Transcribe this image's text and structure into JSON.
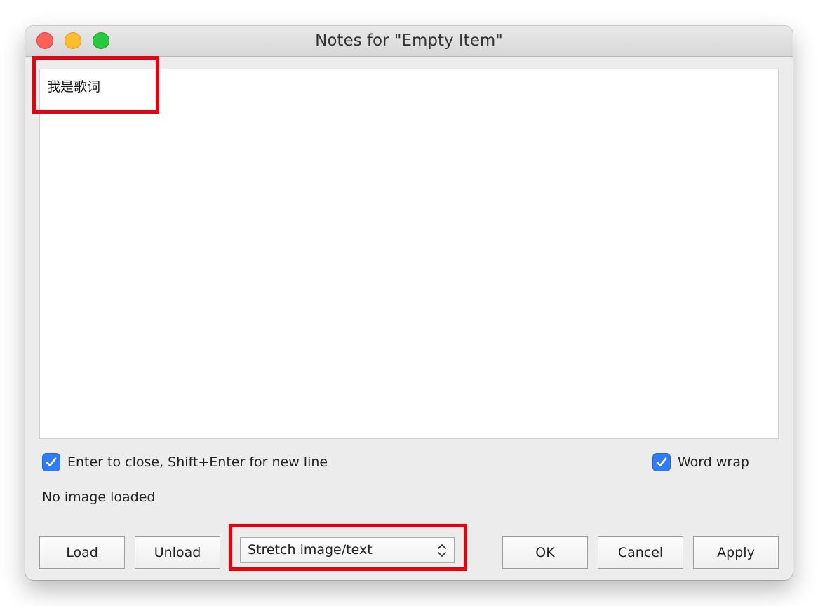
{
  "window": {
    "title": "Notes for \"Empty Item\""
  },
  "notes": {
    "text": "我是歌词"
  },
  "options": {
    "enter_to_close_label": "Enter to close, Shift+Enter for new line",
    "enter_to_close_checked": true,
    "word_wrap_label": "Word wrap",
    "word_wrap_checked": true
  },
  "image_status": "No image loaded",
  "buttons": {
    "load": "Load",
    "unload": "Unload",
    "ok": "OK",
    "cancel": "Cancel",
    "apply": "Apply"
  },
  "display_mode": {
    "selected": "Stretch image/text"
  },
  "colors": {
    "accent": "#2f7cf6",
    "annotation": "#e8000d",
    "close": "#fe5f57",
    "minimize": "#febc2e",
    "maximize": "#28c840"
  },
  "icons": {
    "checkbox": "checkmark-icon",
    "select": "chevron-updown-icon"
  }
}
